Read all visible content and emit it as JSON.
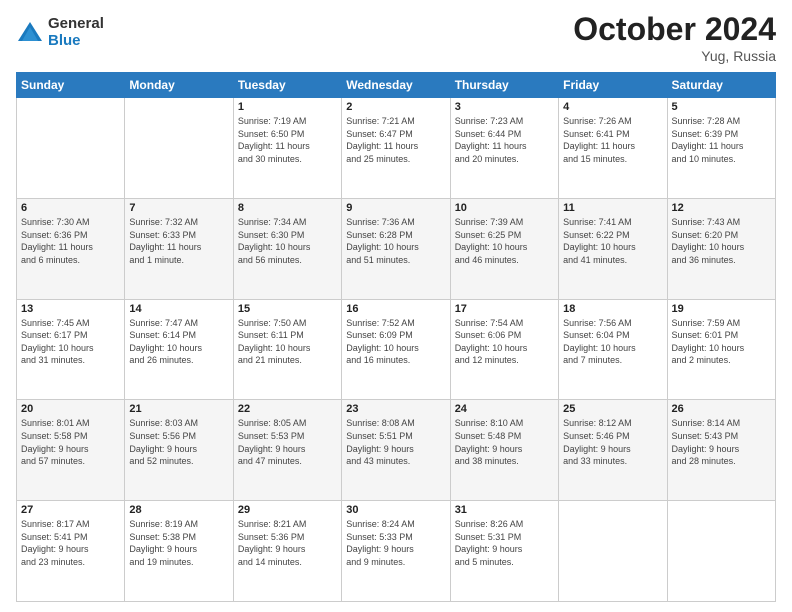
{
  "logo": {
    "general": "General",
    "blue": "Blue"
  },
  "header": {
    "month": "October 2024",
    "location": "Yug, Russia"
  },
  "days_of_week": [
    "Sunday",
    "Monday",
    "Tuesday",
    "Wednesday",
    "Thursday",
    "Friday",
    "Saturday"
  ],
  "weeks": [
    [
      {
        "day": "",
        "info": ""
      },
      {
        "day": "",
        "info": ""
      },
      {
        "day": "1",
        "info": "Sunrise: 7:19 AM\nSunset: 6:50 PM\nDaylight: 11 hours\nand 30 minutes."
      },
      {
        "day": "2",
        "info": "Sunrise: 7:21 AM\nSunset: 6:47 PM\nDaylight: 11 hours\nand 25 minutes."
      },
      {
        "day": "3",
        "info": "Sunrise: 7:23 AM\nSunset: 6:44 PM\nDaylight: 11 hours\nand 20 minutes."
      },
      {
        "day": "4",
        "info": "Sunrise: 7:26 AM\nSunset: 6:41 PM\nDaylight: 11 hours\nand 15 minutes."
      },
      {
        "day": "5",
        "info": "Sunrise: 7:28 AM\nSunset: 6:39 PM\nDaylight: 11 hours\nand 10 minutes."
      }
    ],
    [
      {
        "day": "6",
        "info": "Sunrise: 7:30 AM\nSunset: 6:36 PM\nDaylight: 11 hours\nand 6 minutes."
      },
      {
        "day": "7",
        "info": "Sunrise: 7:32 AM\nSunset: 6:33 PM\nDaylight: 11 hours\nand 1 minute."
      },
      {
        "day": "8",
        "info": "Sunrise: 7:34 AM\nSunset: 6:30 PM\nDaylight: 10 hours\nand 56 minutes."
      },
      {
        "day": "9",
        "info": "Sunrise: 7:36 AM\nSunset: 6:28 PM\nDaylight: 10 hours\nand 51 minutes."
      },
      {
        "day": "10",
        "info": "Sunrise: 7:39 AM\nSunset: 6:25 PM\nDaylight: 10 hours\nand 46 minutes."
      },
      {
        "day": "11",
        "info": "Sunrise: 7:41 AM\nSunset: 6:22 PM\nDaylight: 10 hours\nand 41 minutes."
      },
      {
        "day": "12",
        "info": "Sunrise: 7:43 AM\nSunset: 6:20 PM\nDaylight: 10 hours\nand 36 minutes."
      }
    ],
    [
      {
        "day": "13",
        "info": "Sunrise: 7:45 AM\nSunset: 6:17 PM\nDaylight: 10 hours\nand 31 minutes."
      },
      {
        "day": "14",
        "info": "Sunrise: 7:47 AM\nSunset: 6:14 PM\nDaylight: 10 hours\nand 26 minutes."
      },
      {
        "day": "15",
        "info": "Sunrise: 7:50 AM\nSunset: 6:11 PM\nDaylight: 10 hours\nand 21 minutes."
      },
      {
        "day": "16",
        "info": "Sunrise: 7:52 AM\nSunset: 6:09 PM\nDaylight: 10 hours\nand 16 minutes."
      },
      {
        "day": "17",
        "info": "Sunrise: 7:54 AM\nSunset: 6:06 PM\nDaylight: 10 hours\nand 12 minutes."
      },
      {
        "day": "18",
        "info": "Sunrise: 7:56 AM\nSunset: 6:04 PM\nDaylight: 10 hours\nand 7 minutes."
      },
      {
        "day": "19",
        "info": "Sunrise: 7:59 AM\nSunset: 6:01 PM\nDaylight: 10 hours\nand 2 minutes."
      }
    ],
    [
      {
        "day": "20",
        "info": "Sunrise: 8:01 AM\nSunset: 5:58 PM\nDaylight: 9 hours\nand 57 minutes."
      },
      {
        "day": "21",
        "info": "Sunrise: 8:03 AM\nSunset: 5:56 PM\nDaylight: 9 hours\nand 52 minutes."
      },
      {
        "day": "22",
        "info": "Sunrise: 8:05 AM\nSunset: 5:53 PM\nDaylight: 9 hours\nand 47 minutes."
      },
      {
        "day": "23",
        "info": "Sunrise: 8:08 AM\nSunset: 5:51 PM\nDaylight: 9 hours\nand 43 minutes."
      },
      {
        "day": "24",
        "info": "Sunrise: 8:10 AM\nSunset: 5:48 PM\nDaylight: 9 hours\nand 38 minutes."
      },
      {
        "day": "25",
        "info": "Sunrise: 8:12 AM\nSunset: 5:46 PM\nDaylight: 9 hours\nand 33 minutes."
      },
      {
        "day": "26",
        "info": "Sunrise: 8:14 AM\nSunset: 5:43 PM\nDaylight: 9 hours\nand 28 minutes."
      }
    ],
    [
      {
        "day": "27",
        "info": "Sunrise: 8:17 AM\nSunset: 5:41 PM\nDaylight: 9 hours\nand 23 minutes."
      },
      {
        "day": "28",
        "info": "Sunrise: 8:19 AM\nSunset: 5:38 PM\nDaylight: 9 hours\nand 19 minutes."
      },
      {
        "day": "29",
        "info": "Sunrise: 8:21 AM\nSunset: 5:36 PM\nDaylight: 9 hours\nand 14 minutes."
      },
      {
        "day": "30",
        "info": "Sunrise: 8:24 AM\nSunset: 5:33 PM\nDaylight: 9 hours\nand 9 minutes."
      },
      {
        "day": "31",
        "info": "Sunrise: 8:26 AM\nSunset: 5:31 PM\nDaylight: 9 hours\nand 5 minutes."
      },
      {
        "day": "",
        "info": ""
      },
      {
        "day": "",
        "info": ""
      }
    ]
  ]
}
